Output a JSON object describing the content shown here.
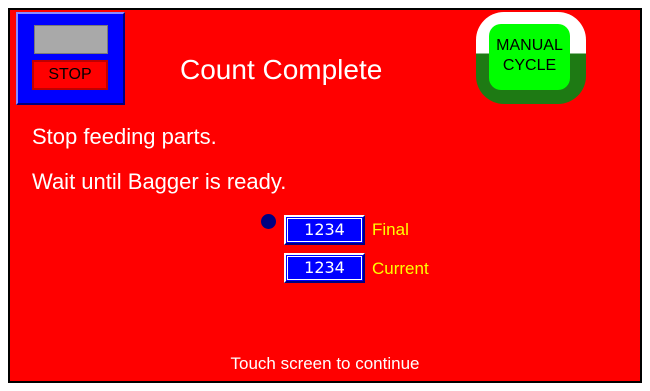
{
  "screen": {
    "title": "Count Complete",
    "background_color": "#ff0000"
  },
  "stop_panel": {
    "stop_label": "STOP"
  },
  "manual_cycle": {
    "line1": "MANUAL",
    "line2": "CYCLE"
  },
  "messages": {
    "line1": "Stop feeding parts.",
    "line2": "Wait until Bagger is ready."
  },
  "counts": {
    "final_value": "1234",
    "final_label": "Final",
    "current_value": "1234",
    "current_label": "Current"
  },
  "footer": {
    "text": "Touch screen to continue"
  },
  "colors": {
    "panel_blue": "#0000ff",
    "label_yellow": "#ffff00",
    "manual_green": "#00ff00",
    "manual_dark_green": "#1e7a14",
    "indicator_navy": "#000080"
  }
}
